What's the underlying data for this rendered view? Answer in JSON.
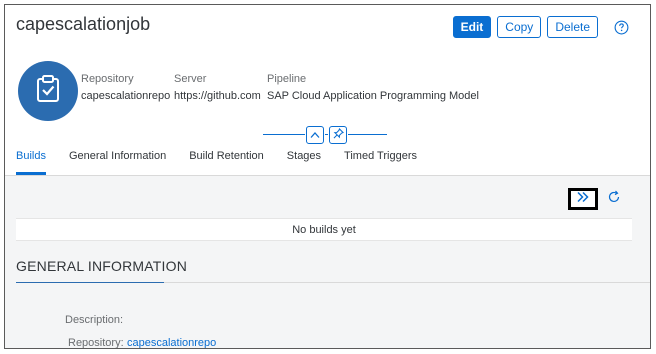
{
  "header": {
    "title": "capescalationjob",
    "edit_label": "Edit",
    "copy_label": "Copy",
    "delete_label": "Delete"
  },
  "meta": {
    "repository_label": "Repository",
    "repository_value": "capescalationrepo",
    "server_label": "Server",
    "server_value": "https://github.com",
    "pipeline_label": "Pipeline",
    "pipeline_value": "SAP Cloud Application Programming Model"
  },
  "tabs": [
    {
      "label": "Builds",
      "active": true
    },
    {
      "label": "General Information",
      "active": false
    },
    {
      "label": "Build Retention",
      "active": false
    },
    {
      "label": "Stages",
      "active": false
    },
    {
      "label": "Timed Triggers",
      "active": false
    }
  ],
  "builds": {
    "empty_text": "No builds yet"
  },
  "general_info": {
    "section_title": "GENERAL INFORMATION",
    "description_label": "Description:",
    "repository_label": "Repository:",
    "repository_value": "capescalationrepo"
  },
  "colors": {
    "accent": "#0a6ed1",
    "avatar": "#2b6cb0",
    "content_bg": "#f4f5f6"
  }
}
